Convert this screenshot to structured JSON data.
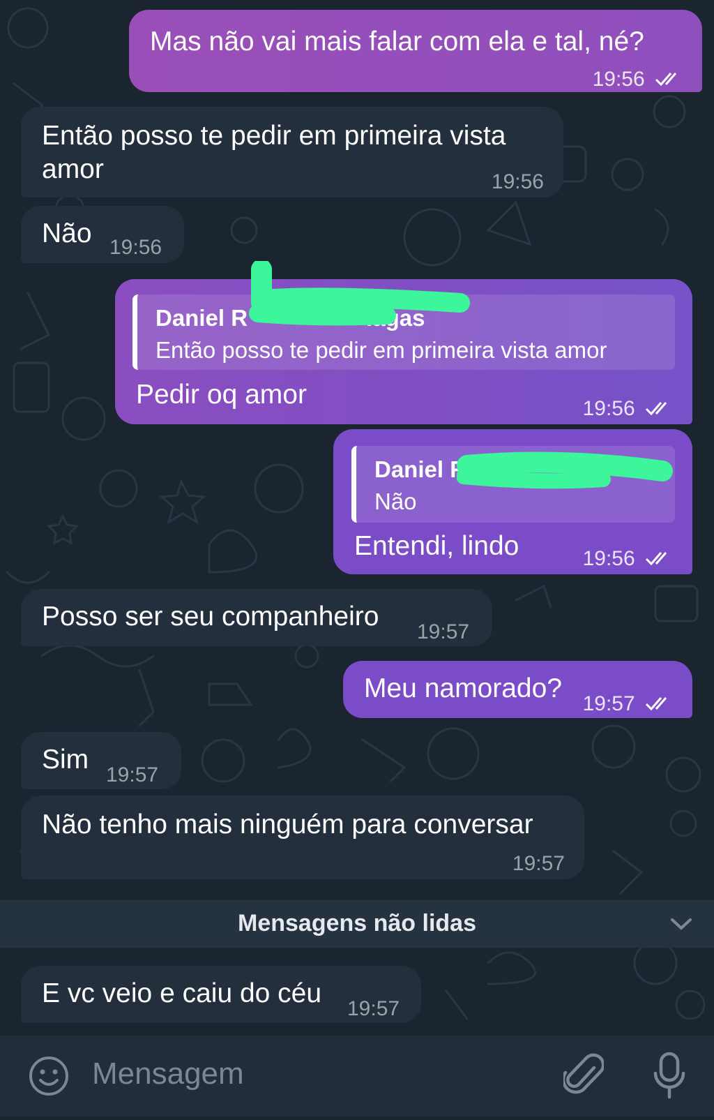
{
  "messages": [
    {
      "text": "Mas não vai mais falar com ela e tal, né?",
      "time": "19:56",
      "direction": "out",
      "status": "read"
    },
    {
      "text_line1": "Então posso te pedir em primeira vista",
      "text_line2": "amor",
      "time": "19:56",
      "direction": "in"
    },
    {
      "text": "Não",
      "time": "19:56",
      "direction": "in"
    },
    {
      "reply_author": "Daniel R",
      "reply_author_tail": "lagas",
      "reply_text": "Então posso te pedir em primeira vista amor",
      "text": "Pedir oq amor",
      "time": "19:56",
      "direction": "out",
      "status": "read"
    },
    {
      "reply_author": "Daniel R",
      "reply_text": "Não",
      "text": "Entendi, lindo",
      "time": "19:56",
      "direction": "out",
      "status": "read"
    },
    {
      "text": "Posso ser seu companheiro",
      "time": "19:57",
      "direction": "in"
    },
    {
      "text": "Meu namorado?",
      "time": "19:57",
      "direction": "out",
      "status": "read"
    },
    {
      "text": "Sim",
      "time": "19:57",
      "direction": "in"
    },
    {
      "text": "Não tenho mais ninguém para conversar",
      "time": "19:57",
      "direction": "in"
    },
    {
      "text": "E vc veio e caiu do céu",
      "time": "19:57",
      "direction": "in"
    }
  ],
  "unread_divider": {
    "label": "Mensagens não lidas"
  },
  "composer": {
    "placeholder": "Mensagem"
  },
  "colors": {
    "background": "#1b2530",
    "incoming_bubble": "#232f3c",
    "outgoing_bubble": "#7f4fc4",
    "redaction": "#3df59a"
  },
  "icons": [
    "double-check-icon",
    "emoji-icon",
    "attach-icon",
    "microphone-icon",
    "chevron-down-icon"
  ]
}
